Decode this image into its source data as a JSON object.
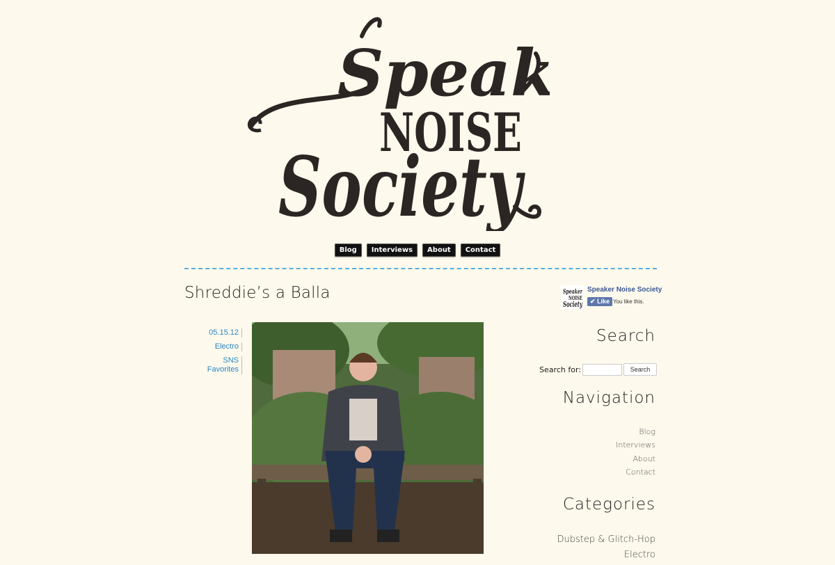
{
  "site": {
    "logo_lines": [
      "Speaker",
      "NOISE",
      "Society"
    ]
  },
  "topnav": {
    "items": [
      {
        "label": "Blog"
      },
      {
        "label": "Interviews"
      },
      {
        "label": "About"
      },
      {
        "label": "Contact"
      }
    ]
  },
  "post": {
    "title": "Shreddie’s a Balla",
    "date": "05.15.12",
    "category": "Electro",
    "tag": "SNS Favorites"
  },
  "facebook": {
    "page_name": "Speaker Noise Society",
    "like_button": "Like",
    "status": "You like this."
  },
  "sidebar": {
    "search": {
      "heading": "Search",
      "label": "Search for:",
      "value": "",
      "button": "Search"
    },
    "navigation": {
      "heading": "Navigation",
      "items": [
        "Blog",
        "Interviews",
        "About",
        "Contact"
      ]
    },
    "categories": {
      "heading": "Categories",
      "items": [
        "Dubstep & Glitch-Hop",
        "Electro"
      ]
    }
  },
  "colors": {
    "background": "#fdf9ec",
    "link": "#2a86c5",
    "divider": "#5aaee0",
    "button": "#111111",
    "facebook": "#3b5998"
  }
}
